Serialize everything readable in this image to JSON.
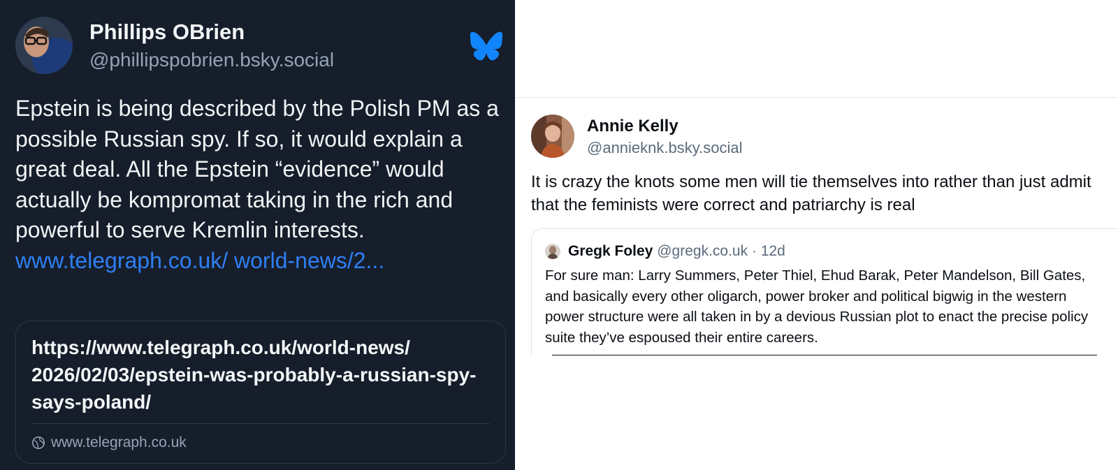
{
  "left_post": {
    "author_name": "Phillips OBrien",
    "author_handle": "@phillipspobrien.bsky.social",
    "body_text": "Epstein is being described by the Polish PM as a possible Russian spy. If so, it would explain a great deal. All the Epstein “evidence” would actually be kompromat taking in the rich and powerful to serve Kremlin interests.",
    "body_link": "www.telegraph.co.uk/ world-news/2...",
    "embed": {
      "title": "https://www.telegraph.co.uk/world-news/ 2026/02/03/epstein-was-probably-a-russian-spy-says-poland/",
      "domain": "www.telegraph.co.uk"
    },
    "icons": {
      "logo": "bluesky-butterfly-icon",
      "globe": "globe-icon"
    },
    "colors": {
      "background": "#161e2b",
      "link": "#2f7ff5",
      "logo": "#1185fe"
    }
  },
  "right_post": {
    "author_name": "Annie Kelly",
    "author_handle": "@annieknk.bsky.social",
    "body_text": "It is crazy the knots some men will tie themselves into rather than just admit that the feminists were correct and patriarchy is real",
    "quote": {
      "author_name": "Gregk Foley",
      "author_handle": "@gregk.co.uk",
      "time_sep": "·",
      "time": "12d",
      "text": "For sure man: Larry Summers, Peter Thiel, Ehud Barak, Peter Mandelson, Bill Gates, and basically every other oligarch, power broker and political bigwig in the western power structure were all taken in by a devious Russian plot to enact the precise policy suite they’ve espoused their entire careers."
    },
    "colors": {
      "background": "#ffffff",
      "secondary_text": "#5b6b7d"
    }
  }
}
